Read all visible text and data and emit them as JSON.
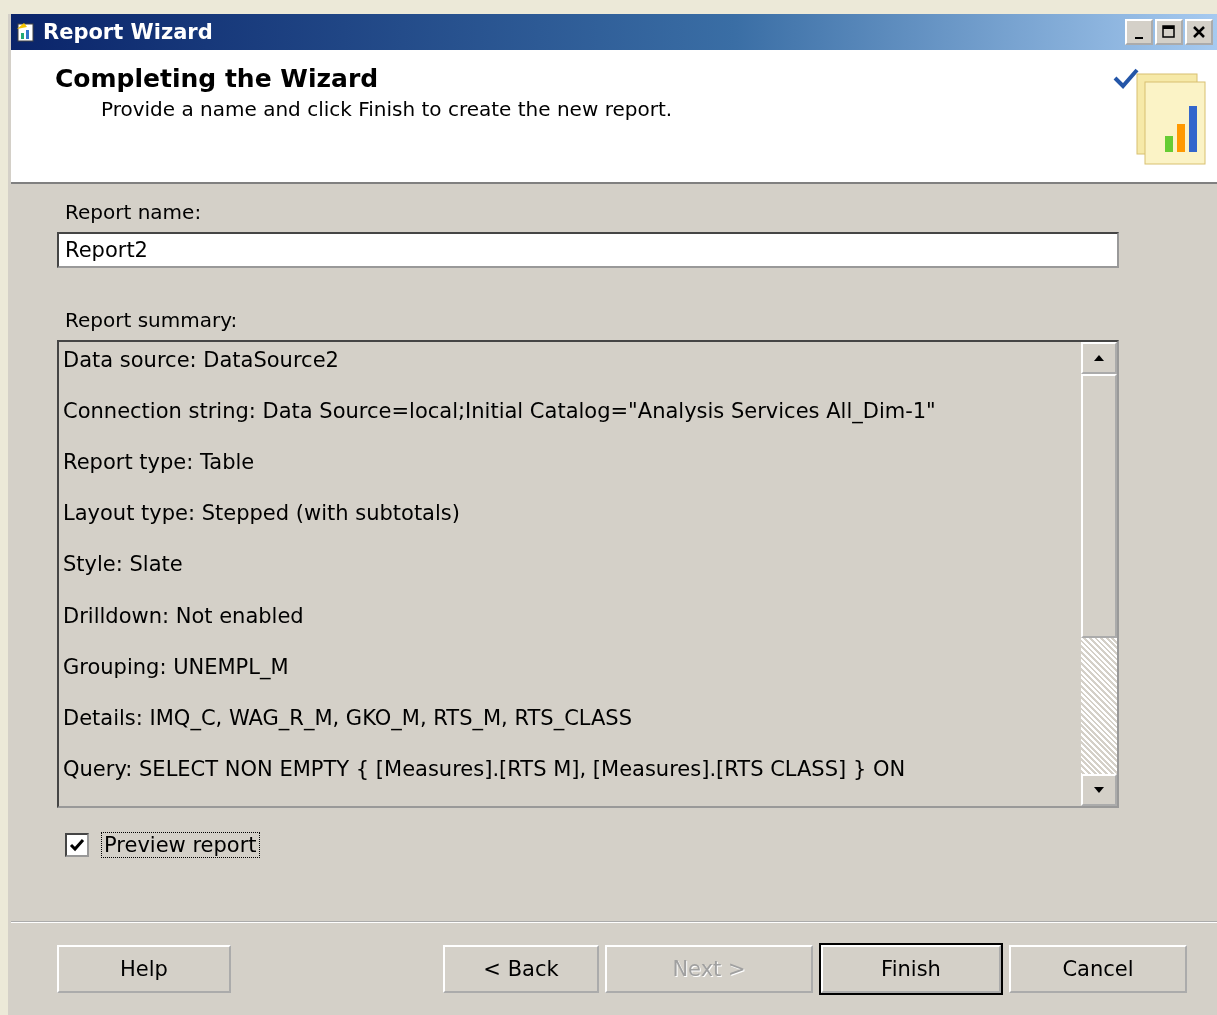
{
  "window": {
    "title": "Report Wizard"
  },
  "header": {
    "title": "Completing the Wizard",
    "subtitle": "Provide a name and click Finish to create the new report."
  },
  "report_name": {
    "label": "Report name:",
    "value": "Report2"
  },
  "summary": {
    "label": "Report summary:",
    "lines": [
      "Data source: DataSource2",
      "Connection string: Data Source=local;Initial Catalog=\"Analysis Services All_Dim-1\"",
      "Report type: Table",
      "Layout type: Stepped (with subtotals)",
      "Style: Slate",
      "Drilldown: Not enabled",
      "Grouping: UNEMPL_M",
      "Details: IMQ_C, WAG_R_M, GKO_M, RTS_M, RTS_CLASS",
      "Query:  SELECT NON EMPTY { [Measures].[RTS M], [Measures].[RTS CLASS] } ON"
    ]
  },
  "preview": {
    "label": "Preview report",
    "checked": true
  },
  "buttons": [
    {
      "label": "Help",
      "disabled": false,
      "default": false
    },
    {
      "label": "< Back",
      "disabled": false,
      "default": false
    },
    {
      "label": "Next >",
      "disabled": true,
      "default": false
    },
    {
      "label": "Finish",
      "disabled": false,
      "default": true
    },
    {
      "label": "Cancel",
      "disabled": false,
      "default": false
    }
  ]
}
